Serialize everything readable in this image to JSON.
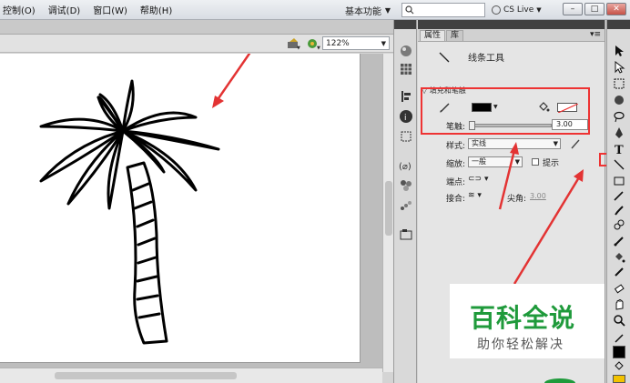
{
  "menubar": {
    "items": [
      "控制(O)",
      "调试(D)",
      "窗口(W)",
      "帮助(H)"
    ],
    "workspace": "基本功能",
    "cs_live": "CS Live"
  },
  "stage": {
    "zoom": "122%"
  },
  "panel": {
    "tabs": [
      "属性",
      "库"
    ],
    "tool_name": "线条工具",
    "section_title": "填充和笔触",
    "stroke_label": "笔触:",
    "stroke_value": "3.00",
    "style_label": "样式:",
    "style_value": "实线",
    "scale_label": "缩放:",
    "scale_value": "一般",
    "hint_label": "提示",
    "cap_label": "端点:",
    "join_label": "接合:",
    "miter_label": "尖角:",
    "miter_value": "3.00"
  },
  "colors": {
    "stroke_color": "#000000",
    "annotation_red": "#e33333",
    "watermark_green": "#1f9a3b"
  },
  "watermark": {
    "title": "百科全说",
    "subtitle": "助你轻松解决"
  },
  "icons": {
    "line_tool": "line-tool-icon",
    "pencil": "pencil-icon",
    "bucket": "paint-bucket-icon"
  }
}
